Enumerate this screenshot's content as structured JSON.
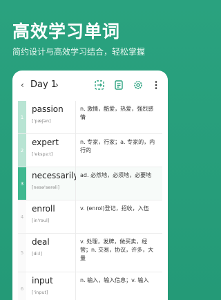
{
  "promo": {
    "headline": "高效学习单词",
    "subline": "简约设计与高效学习结合，轻松掌握"
  },
  "toolbar": {
    "day_label": "Day 1",
    "prev_glyph": "‹",
    "next_glyph": "›",
    "icons": [
      "shuffle-icon",
      "book-icon",
      "gear-icon",
      "more-icon"
    ]
  },
  "words": [
    {
      "index": "1",
      "word": "passion",
      "phonetic": "['pæʃən]",
      "definition": "n. 激情，酷爱，热爱，强烈感情"
    },
    {
      "index": "2",
      "word": "expert",
      "phonetic": "['ekspɜːt]",
      "definition": "n. 专家，行家；a. 专家的，内行的"
    },
    {
      "index": "3",
      "word": "necessarily",
      "phonetic": "[nesə'serəli]",
      "definition": "ad. 必然地，必须地，必要地"
    },
    {
      "index": "4",
      "word": "enroll",
      "phonetic": "[in'rəul]",
      "definition": "v. (enrol)登记，招收，入伍"
    },
    {
      "index": "5",
      "word": "deal",
      "phonetic": "[diːl]",
      "definition": "v. 处理，发牌，做买卖，经营；n. 交易，协议，许多，大量"
    },
    {
      "index": "6",
      "word": "input",
      "phonetic": "['input]",
      "definition": "n. 输入，输入信息；v. 输入"
    }
  ],
  "colors": {
    "background": "#2aa27f",
    "accent": "#3fb88f",
    "accent_light": "#b8e4d3"
  }
}
